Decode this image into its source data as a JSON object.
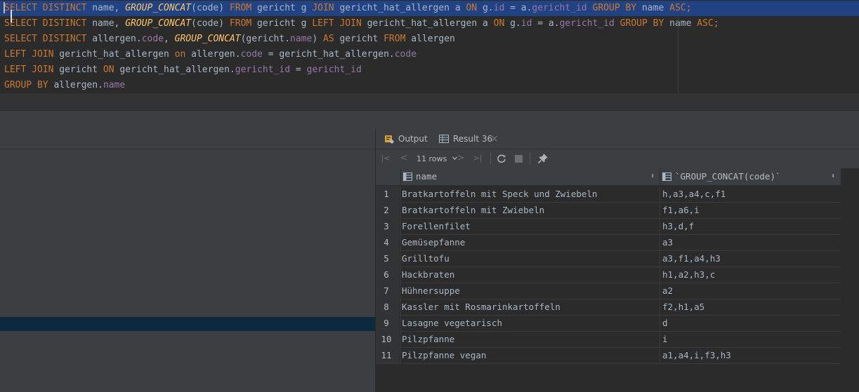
{
  "editor": {
    "lines": [
      [
        [
          "k",
          "SELECT DISTINCT"
        ],
        [
          "t",
          " name, "
        ],
        [
          "f",
          "GROUP_CONCAT"
        ],
        [
          "t",
          "(code) "
        ],
        [
          "k",
          "FROM"
        ],
        [
          "t",
          " gericht g "
        ],
        [
          "k",
          "JOIN"
        ],
        [
          "t",
          " gericht_hat_allergen a "
        ],
        [
          "k",
          "ON"
        ],
        [
          "t",
          " g."
        ],
        [
          "fld",
          "id"
        ],
        [
          "t",
          " = a."
        ],
        [
          "fld",
          "gericht_id"
        ],
        [
          "t",
          " "
        ],
        [
          "k",
          "GROUP BY"
        ],
        [
          "t",
          " name "
        ],
        [
          "k",
          "ASC;"
        ]
      ],
      [
        [
          "k",
          "SELECT DISTINCT"
        ],
        [
          "t",
          " name, "
        ],
        [
          "f",
          "GROUP_CONCAT"
        ],
        [
          "t",
          "(code) "
        ],
        [
          "k",
          "FROM"
        ],
        [
          "t",
          " gericht g "
        ],
        [
          "k",
          "LEFT JOIN"
        ],
        [
          "t",
          " gericht_hat_allergen a "
        ],
        [
          "k",
          "ON"
        ],
        [
          "t",
          " g."
        ],
        [
          "fld",
          "id"
        ],
        [
          "t",
          " = a."
        ],
        [
          "fld",
          "gericht_id"
        ],
        [
          "t",
          " "
        ],
        [
          "k",
          "GROUP BY"
        ],
        [
          "t",
          " name "
        ],
        [
          "k",
          "ASC;"
        ]
      ],
      [
        [
          "k",
          "SELECT DISTINCT"
        ],
        [
          "t",
          " allergen."
        ],
        [
          "fld",
          "code"
        ],
        [
          "t",
          ", "
        ],
        [
          "f",
          "GROUP_CONCAT"
        ],
        [
          "t",
          "(gericht."
        ],
        [
          "fld",
          "name"
        ],
        [
          "t",
          ") "
        ],
        [
          "k",
          "AS"
        ],
        [
          "t",
          " gericht "
        ],
        [
          "k",
          "FROM"
        ],
        [
          "t",
          " allergen"
        ]
      ],
      [
        [
          "k",
          "LEFT JOIN"
        ],
        [
          "t",
          " gericht_hat_allergen "
        ],
        [
          "k",
          "on"
        ],
        [
          "t",
          " allergen."
        ],
        [
          "fld",
          "code"
        ],
        [
          "t",
          " = gericht_hat_allergen."
        ],
        [
          "fld",
          "code"
        ]
      ],
      [
        [
          "k",
          "LEFT JOIN"
        ],
        [
          "t",
          " gericht "
        ],
        [
          "k",
          "ON"
        ],
        [
          "t",
          " gericht_hat_allergen."
        ],
        [
          "fld",
          "gericht_id"
        ],
        [
          "t",
          " = "
        ],
        [
          "fld",
          "gericht_id"
        ]
      ],
      [
        [
          "k",
          "GROUP BY"
        ],
        [
          "t",
          " allergen."
        ],
        [
          "fld",
          "name"
        ]
      ]
    ]
  },
  "tabs": {
    "output_label": "Output",
    "result_label": "Result 36",
    "close_glyph": "×"
  },
  "toolbar": {
    "rows_label": "11 rows",
    "first_glyph": "|<",
    "prev_glyph": "<",
    "next_glyph": ">",
    "last_glyph": ">|"
  },
  "grid": {
    "columns": [
      "name",
      "`GROUP_CONCAT(code)`"
    ],
    "rows": [
      {
        "n": "1",
        "name": "Bratkartoffeln mit Speck und Zwiebeln",
        "codes": "h,a3,a4,c,f1"
      },
      {
        "n": "2",
        "name": "Bratkartoffeln mit Zwiebeln",
        "codes": "f1,a6,i"
      },
      {
        "n": "3",
        "name": "Forellenfilet",
        "codes": "h3,d,f"
      },
      {
        "n": "4",
        "name": "Gemüsepfanne",
        "codes": "a3"
      },
      {
        "n": "5",
        "name": "Grilltofu",
        "codes": "a3,f1,a4,h3"
      },
      {
        "n": "6",
        "name": "Hackbraten",
        "codes": "h1,a2,h3,c"
      },
      {
        "n": "7",
        "name": "Hühnersuppe",
        "codes": "a2"
      },
      {
        "n": "8",
        "name": "Kassler mit Rosmarinkartoffeln",
        "codes": "f2,h1,a5"
      },
      {
        "n": "9",
        "name": "Lasagne vegetarisch",
        "codes": "d"
      },
      {
        "n": "10",
        "name": "Pilzpfanne",
        "codes": "i"
      },
      {
        "n": "11",
        "name": "Pilzpfanne vegan",
        "codes": "a1,a4,i,f3,h3"
      }
    ]
  }
}
